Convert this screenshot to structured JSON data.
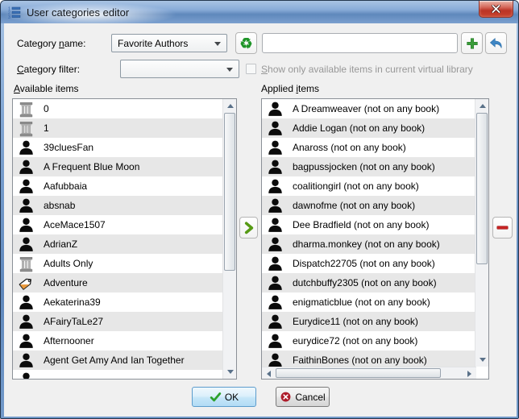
{
  "window": {
    "title": "User categories editor"
  },
  "form": {
    "category_name_label": {
      "pre": "Category ",
      "mn": "n",
      "post": "ame:"
    },
    "category_name_value": "Favorite Authors",
    "new_category_value": "",
    "category_filter_label": {
      "pre": "",
      "mn": "C",
      "post": "ategory filter:"
    },
    "category_filter_value": "",
    "vl_checkbox_label": {
      "pre": "",
      "mn": "S",
      "post": "how only available items in current virtual library"
    },
    "vl_checkbox_checked": false
  },
  "available": {
    "header": {
      "pre": "",
      "mn": "A",
      "post": "vailable items"
    },
    "items": [
      {
        "icon": "column",
        "label": "0"
      },
      {
        "icon": "column",
        "label": "1"
      },
      {
        "icon": "user",
        "label": "39cluesFan"
      },
      {
        "icon": "user",
        "label": "A Frequent Blue Moon"
      },
      {
        "icon": "user",
        "label": "Aafubbaia"
      },
      {
        "icon": "user",
        "label": "absnab"
      },
      {
        "icon": "user",
        "label": "AceMace1507"
      },
      {
        "icon": "user",
        "label": "AdrianZ"
      },
      {
        "icon": "column",
        "label": "Adults Only"
      },
      {
        "icon": "tag",
        "label": "Adventure"
      },
      {
        "icon": "user",
        "label": "Aekaterina39"
      },
      {
        "icon": "user",
        "label": "AFairyTaLe27"
      },
      {
        "icon": "user",
        "label": "Afternooner"
      },
      {
        "icon": "user",
        "label": "Agent Get Amy And Ian Together"
      },
      {
        "icon": "user",
        "label": ""
      }
    ]
  },
  "applied": {
    "header": {
      "pre": "Applied ",
      "mn": "i",
      "post": "tems"
    },
    "items": [
      {
        "icon": "user",
        "label": "A Dreamweaver (not on any book)"
      },
      {
        "icon": "user",
        "label": "Addie Logan (not on any book)"
      },
      {
        "icon": "user",
        "label": "Anaross (not on any book)"
      },
      {
        "icon": "user",
        "label": "bagpussjocken (not on any book)"
      },
      {
        "icon": "user",
        "label": "coalitiongirl (not on any book)"
      },
      {
        "icon": "user",
        "label": "dawnofme (not on any book)"
      },
      {
        "icon": "user",
        "label": "Dee Bradfield (not on any book)"
      },
      {
        "icon": "user",
        "label": "dharma.monkey (not on any book)"
      },
      {
        "icon": "user",
        "label": "Dispatch22705 (not on any book)"
      },
      {
        "icon": "user",
        "label": "dutchbuffy2305 (not on any book)"
      },
      {
        "icon": "user",
        "label": "enigmaticblue (not on any book)"
      },
      {
        "icon": "user",
        "label": "Eurydice11 (not on any book)"
      },
      {
        "icon": "user",
        "label": "eurydice72 (not on any book)"
      },
      {
        "icon": "user",
        "label": "FaithinBones (not on any book)"
      }
    ]
  },
  "buttons": {
    "ok": "OK",
    "cancel": "Cancel"
  },
  "icons": {
    "titlebar": "numbered-list",
    "close": "close-x",
    "new_category": "recycle",
    "recycle_glyph": "♻",
    "add_category": "plus",
    "rename_category": "undo-arrow",
    "apply_item": "right-chevron",
    "unapply_item": "minus",
    "ok": "green-check",
    "cancel": "red-x-circle",
    "item_types": [
      "user",
      "column",
      "tag"
    ]
  },
  "colors": {
    "titlebar_blue": "#7fa4d2",
    "accent_green": "#3a9c3a",
    "accent_red": "#c62323",
    "undo_blue": "#3f86c4",
    "ok_border_blue": "#5c9ccc",
    "row_alt": "#e7e7e7",
    "dialog_bg": "#f0f0f0"
  }
}
